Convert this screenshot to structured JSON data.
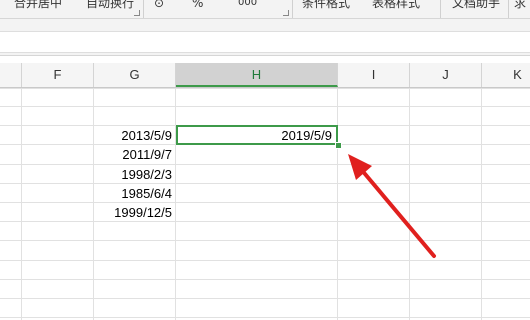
{
  "ribbon": {
    "items": [
      "合并居中",
      "自动换行",
      "⊙",
      "%",
      "000",
      "条件格式",
      "表格样式",
      "文档助手",
      "求"
    ]
  },
  "columns": [
    "F",
    "G",
    "H",
    "I",
    "J",
    "K"
  ],
  "active_column": "H",
  "cells": {
    "G": [
      "2013/5/9",
      "2011/9/7",
      "1998/2/3",
      "1985/6/4",
      "1999/12/5"
    ],
    "H": [
      "2019/5/9"
    ]
  },
  "colors": {
    "selection": "#3d9a4a",
    "arrow": "#e0201e",
    "active_header": "#d2d2d2"
  }
}
